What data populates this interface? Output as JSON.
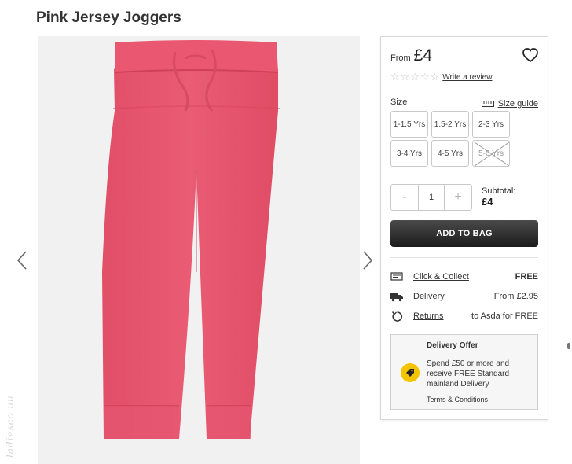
{
  "product": {
    "title": "Pink Jersey Joggers",
    "price_prefix": "From",
    "price": "£4",
    "rating_stars": 0,
    "write_review": "Write a review"
  },
  "sizes": {
    "label": "Size",
    "guide_label": "Size guide",
    "options": [
      {
        "label": "1-1.5 Yrs",
        "available": true
      },
      {
        "label": "1.5-2 Yrs",
        "available": true
      },
      {
        "label": "2-3 Yrs",
        "available": true
      },
      {
        "label": "3-4 Yrs",
        "available": true
      },
      {
        "label": "4-5 Yrs",
        "available": true
      },
      {
        "label": "5-6 Yrs",
        "available": false
      }
    ]
  },
  "quantity": {
    "minus": "-",
    "value": "1",
    "plus": "+"
  },
  "subtotal": {
    "label": "Subtotal:",
    "value": "£4"
  },
  "add_to_bag": "ADD TO BAG",
  "services": [
    {
      "icon": "click-collect-icon",
      "label": "Click & Collect",
      "value": "FREE",
      "bold": true
    },
    {
      "icon": "delivery-truck-icon",
      "label": "Delivery",
      "value": "From £2.95",
      "bold": false
    },
    {
      "icon": "returns-icon",
      "label": "Returns",
      "value": "to Asda for FREE",
      "bold": false
    }
  ],
  "delivery_offer": {
    "title": "Delivery Offer",
    "text": "Spend £50 or more and receive FREE Standard mainland Delivery",
    "link": "Terms & Conditions"
  },
  "watermark": "ladiesco.uu",
  "colors": {
    "jogger_pink": "#e8566f",
    "offer_tag": "#f5c400",
    "button_dark": "#1c1c1c"
  }
}
